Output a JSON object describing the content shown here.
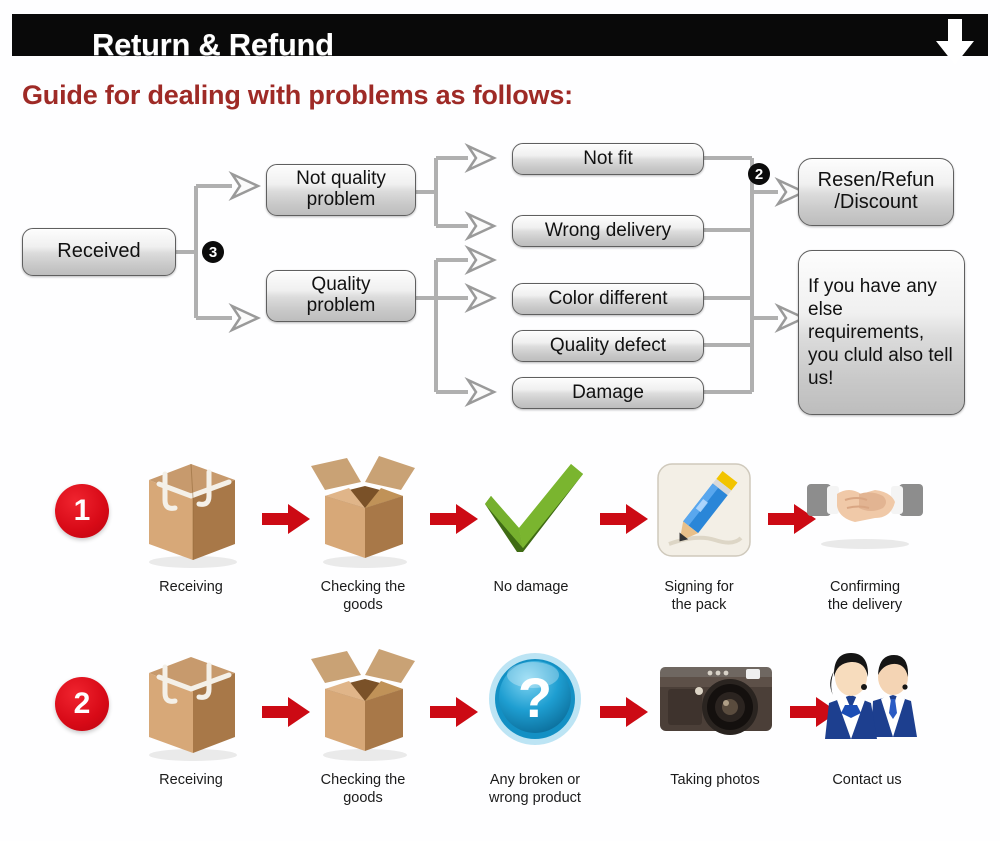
{
  "header": {
    "title": "Return & Refund",
    "arrow_icon": "down-arrow-icon"
  },
  "guide": {
    "heading": "Guide for dealing with problems as follows:"
  },
  "colors": {
    "header_bar": "#090909",
    "header_text": "#ffffff",
    "guide_text": "#9e2a26",
    "badge_red": "#d80a17",
    "arrow_red": "#cc0a14",
    "badge_dark": "#0b0b0b",
    "box_border": "#5f5f5f",
    "connector": "#b8b8b8",
    "page_background": "#fefeff"
  },
  "flowchart": {
    "type": "decision-tree",
    "nodes": {
      "received": "Received",
      "not_quality_problem": "Not quality\nproblem",
      "quality_problem": "Quality\nproblem",
      "not_fit": "Not fit",
      "wrong_delivery": "Wrong delivery",
      "color_different": "Color different",
      "quality_defect": "Quality defect",
      "damage": "Damage",
      "resend_refund_discount": "Resen/Refun\n/Discount",
      "other_requirements": "If you have any else requirements, you cluld also tell us!"
    },
    "badges": {
      "branch_three": "3",
      "branch_two": "2"
    }
  },
  "process_rows": [
    {
      "badge": "1",
      "steps": [
        {
          "label": "Receiving",
          "icon": "sealed-box-icon"
        },
        {
          "label": "Checking the\ngoods",
          "icon": "open-box-icon"
        },
        {
          "label": "No damage",
          "icon": "green-check-icon"
        },
        {
          "label": "Signing for\nthe pack",
          "icon": "pencil-signing-icon"
        },
        {
          "label": "Confirming\nthe delivery",
          "icon": "handshake-icon"
        }
      ]
    },
    {
      "badge": "2",
      "steps": [
        {
          "label": "Receiving",
          "icon": "sealed-box-icon"
        },
        {
          "label": "Checking the\ngoods",
          "icon": "open-box-icon"
        },
        {
          "label": "Any broken or\nwrong product",
          "icon": "question-mark-icon"
        },
        {
          "label": "Taking photos",
          "icon": "camera-icon"
        },
        {
          "label": "Contact us",
          "icon": "support-agents-icon"
        }
      ]
    }
  ]
}
